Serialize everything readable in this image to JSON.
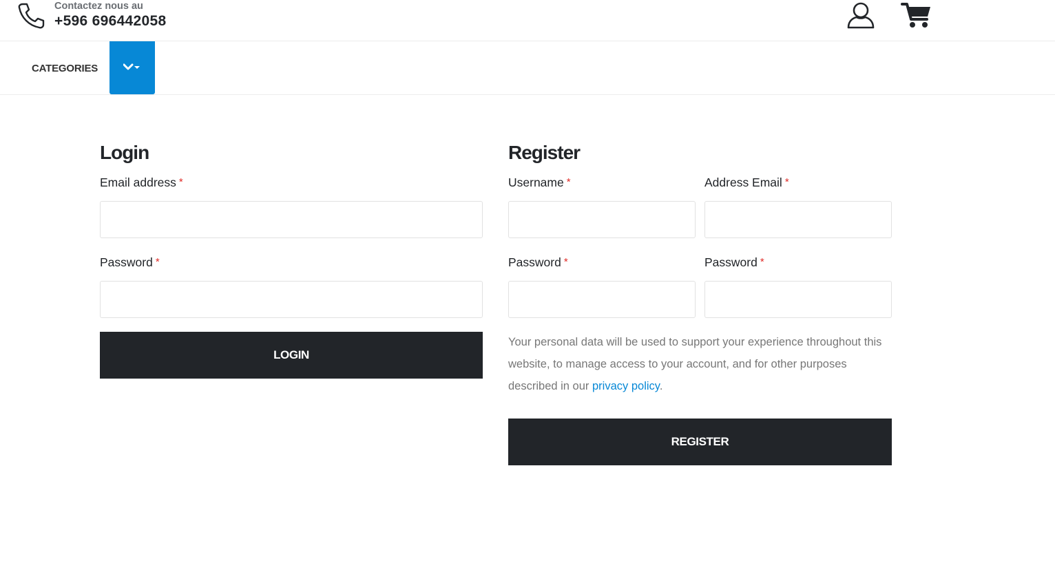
{
  "header": {
    "contact_label": "Contactez nous au",
    "contact_number": "+596 696442058",
    "icons": {
      "phone": "phone-icon",
      "account": "user-icon",
      "cart": "cart-icon"
    }
  },
  "nav": {
    "categories_label": "CATEGORIES",
    "toggle_icon": "chevron-down-icon"
  },
  "login": {
    "title": "Login",
    "email_label": "Email address",
    "password_label": "Password",
    "required_mark": "*",
    "email_value": "",
    "password_value": "",
    "submit_label": "LOGIN"
  },
  "register": {
    "title": "Register",
    "username_label": "Username",
    "email_label": "Address Email",
    "password_label": "Password",
    "password2_label": "Password",
    "required_mark": "*",
    "privacy_text": "Your personal data will be used to support your experience throughout this website, to manage access to your account, and for other purposes described in our ",
    "privacy_link": "privacy policy",
    "privacy_end": ".",
    "submit_label": "REGISTER"
  },
  "colors": {
    "accent": "#0788d6",
    "button_bg": "#222529",
    "required": "#e02b27",
    "muted_text": "#777777"
  }
}
